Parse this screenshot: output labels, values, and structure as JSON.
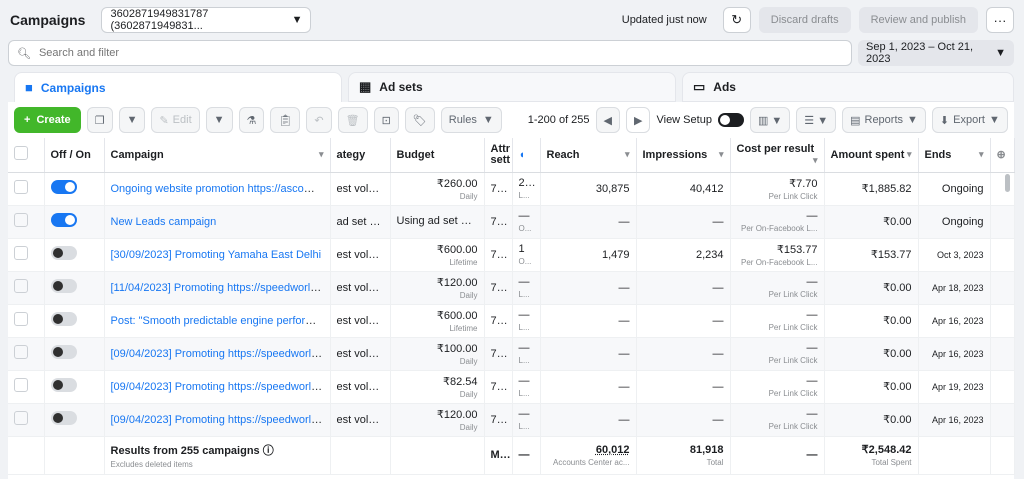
{
  "header": {
    "title": "Campaigns",
    "account": "3602871949831787 (3602871949831...",
    "updated": "Updated just now",
    "discard": "Discard drafts",
    "review": "Review and publish",
    "more": "···"
  },
  "search": {
    "placeholder": "Search and filter"
  },
  "date_range": "Sep 1, 2023 – Oct 21, 2023",
  "tabs": [
    {
      "label": "Campaigns"
    },
    {
      "label": "Ad sets"
    },
    {
      "label": "Ads"
    }
  ],
  "toolbar": {
    "create": "Create",
    "edit": "Edit",
    "rules": "Rules",
    "pager": "1-200 of 255",
    "view_setup": "View Setup",
    "reports": "Reports",
    "export": "Export"
  },
  "columns": {
    "offon": "Off / On",
    "campaign": "Campaign",
    "strategy": "ategy",
    "budget": "Budget",
    "attr": "Attr sett",
    "reach": "Reach",
    "impressions": "Impressions",
    "cpr": "Cost per result",
    "spent": "Amount spent",
    "ends": "Ends"
  },
  "rows": [
    {
      "on": true,
      "name": "Ongoing website promotion https://ascomot...",
      "strategy": "est volume",
      "budget": "₹260.00",
      "budget_sub": "Daily",
      "attr": "7...",
      "f": "2...",
      "f_sub": "L...",
      "reach": "30,875",
      "impressions": "40,412",
      "cpr": "₹7.70",
      "cpr_sub": "Per Link Click",
      "spent": "₹1,885.82",
      "ends": "Ongoing"
    },
    {
      "on": true,
      "name": "New Leads campaign",
      "strategy": "ad set bid...",
      "budget": "Using ad set bu...",
      "budget_sub": "",
      "attr": "7...",
      "f": "—",
      "f_sub": "O...",
      "reach": "—",
      "impressions": "—",
      "cpr": "—",
      "cpr_sub": "Per On-Facebook L...",
      "spent": "₹0.00",
      "ends": "Ongoing"
    },
    {
      "on": false,
      "name": "[30/09/2023] Promoting Yamaha East Delhi",
      "strategy": "est volume",
      "budget": "₹600.00",
      "budget_sub": "Lifetime",
      "attr": "7...",
      "f": "1",
      "f_sub": "O...",
      "reach": "1,479",
      "impressions": "2,234",
      "cpr": "₹153.77",
      "cpr_sub": "Per On-Facebook L...",
      "spent": "₹153.77",
      "ends": "Oct 3, 2023"
    },
    {
      "on": false,
      "name": "[11/04/2023] Promoting https://speedworld.i...",
      "strategy": "est volume",
      "budget": "₹120.00",
      "budget_sub": "Daily",
      "attr": "7...",
      "f": "—",
      "f_sub": "L...",
      "reach": "—",
      "impressions": "—",
      "cpr": "—",
      "cpr_sub": "Per Link Click",
      "spent": "₹0.00",
      "ends": "Apr 18, 2023"
    },
    {
      "on": false,
      "name": "Post: \"Smooth predictable engine performanc...",
      "strategy": "est volume",
      "budget": "₹600.00",
      "budget_sub": "Lifetime",
      "attr": "7...",
      "f": "—",
      "f_sub": "L...",
      "reach": "—",
      "impressions": "—",
      "cpr": "—",
      "cpr_sub": "Per Link Click",
      "spent": "₹0.00",
      "ends": "Apr 16, 2023"
    },
    {
      "on": false,
      "name": "[09/04/2023] Promoting https://speedworld.i...",
      "strategy": "est volume",
      "budget": "₹100.00",
      "budget_sub": "Daily",
      "attr": "7...",
      "f": "—",
      "f_sub": "L...",
      "reach": "—",
      "impressions": "—",
      "cpr": "—",
      "cpr_sub": "Per Link Click",
      "spent": "₹0.00",
      "ends": "Apr 16, 2023"
    },
    {
      "on": false,
      "name": "[09/04/2023] Promoting https://speedworld.i...",
      "strategy": "est volume",
      "budget": "₹82.54",
      "budget_sub": "Daily",
      "attr": "7...",
      "f": "—",
      "f_sub": "L...",
      "reach": "—",
      "impressions": "—",
      "cpr": "—",
      "cpr_sub": "Per Link Click",
      "spent": "₹0.00",
      "ends": "Apr 19, 2023"
    },
    {
      "on": false,
      "name": "[09/04/2023] Promoting https://speedworld.i...",
      "strategy": "est volume",
      "budget": "₹120.00",
      "budget_sub": "Daily",
      "attr": "7...",
      "f": "—",
      "f_sub": "L...",
      "reach": "—",
      "impressions": "—",
      "cpr": "—",
      "cpr_sub": "Per Link Click",
      "spent": "₹0.00",
      "ends": "Apr 16, 2023"
    }
  ],
  "footer": {
    "label": "Results from 255 campaigns",
    "sub": "Excludes deleted items",
    "attr": "M...",
    "f": "—",
    "reach": "60,012",
    "reach_sub": "Accounts Center ac...",
    "impressions": "81,918",
    "impressions_sub": "Total",
    "cpr": "—",
    "spent": "₹2,548.42",
    "spent_sub": "Total Spent"
  }
}
